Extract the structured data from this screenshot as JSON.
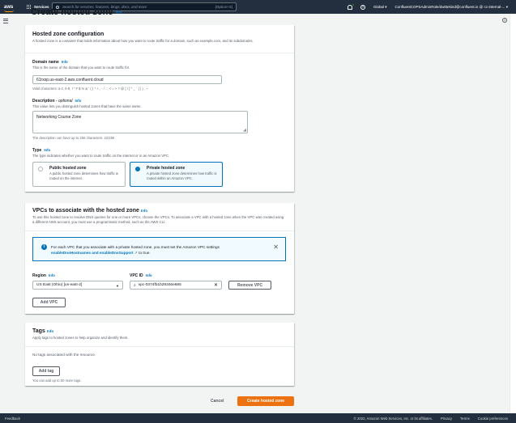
{
  "nav": {
    "logo": "aws",
    "services": "Services",
    "search_placeholder": "Search for services, features, blogs, docs, and more",
    "search_shortcut": "[Option+S]",
    "region": "Global",
    "account": "ConfluentCOPSAdminRole/dwittekind@confluent.io @ cc-internal-..."
  },
  "page": {
    "title": "Create hosted zone",
    "title_info": "Info"
  },
  "config": {
    "heading": "Hosted zone configuration",
    "description": "A hosted zone is a container that holds information about how you want to route traffic for a domain, such as example.com, and its subdomains.",
    "domain_label": "Domain name",
    "domain_info": "Info",
    "domain_desc": "This is the name of the domain that you want to route traffic for.",
    "domain_value": "61rxsp.us-east-2.aws.confluent.cloud",
    "domain_constraint": "Valid characters: a-z, 0-9, ! \" # $ % & ' ( ) * + , - / : ; < = > ? @ [ \\ ] ^ _ ` { | } . ~",
    "desc_label": "Description",
    "desc_optional": "- optional",
    "desc_info": "Info",
    "desc_desc": "This value lets you distinguish hosted zones that have the same name.",
    "desc_value": "Networking Course Zone",
    "desc_constraint": "The description can have up to 256 characters. 22/256",
    "type_label": "Type",
    "type_info": "Info",
    "type_desc": "The type indicates whether you want to route traffic on the internet or in an Amazon VPC.",
    "public_title": "Public hosted zone",
    "public_desc": "A public hosted zone determines how traffic is routed on the internet.",
    "private_title": "Private hosted zone",
    "private_desc": "A private hosted zone determines how traffic is routed within an Amazon VPC."
  },
  "vpcs": {
    "heading": "VPCs to associate with the hosted zone",
    "heading_info": "Info",
    "description": "To use this hosted zone to resolve DNS queries for one or more VPCs, choose the VPCs. To associate a VPC with a hosted zone when the VPC was created using a different AWS account, you must use a programmatic method, such as the AWS CLI.",
    "alert_text": "For each VPC that you associate with a private hosted zone, you must set the Amazon VPC settings",
    "alert_link": "enableDnsHostnames and enableDnsSupport",
    "alert_suffix": "to true.",
    "region_label": "Region",
    "region_info": "Info",
    "region_value": "US East (Ohio) [us-east-2]",
    "vpc_label": "VPC ID",
    "vpc_info": "Info",
    "vpc_value": "vpc-0374fb1b29346e685",
    "remove_button": "Remove VPC",
    "add_button": "Add VPC"
  },
  "tags": {
    "heading": "Tags",
    "heading_info": "Info",
    "description": "Apply tags to hosted zones to help organize and identify them.",
    "empty": "No tags associated with the resource.",
    "add_button": "Add tag",
    "limit": "You can add up to 50 more tags."
  },
  "actions": {
    "cancel": "Cancel",
    "create": "Create hosted zone"
  },
  "footer": {
    "feedback": "Feedback",
    "copyright": "© 2022, Amazon Web Services, Inc. or its affiliates.",
    "privacy": "Privacy",
    "terms": "Terms",
    "cookies": "Cookie preferences"
  }
}
